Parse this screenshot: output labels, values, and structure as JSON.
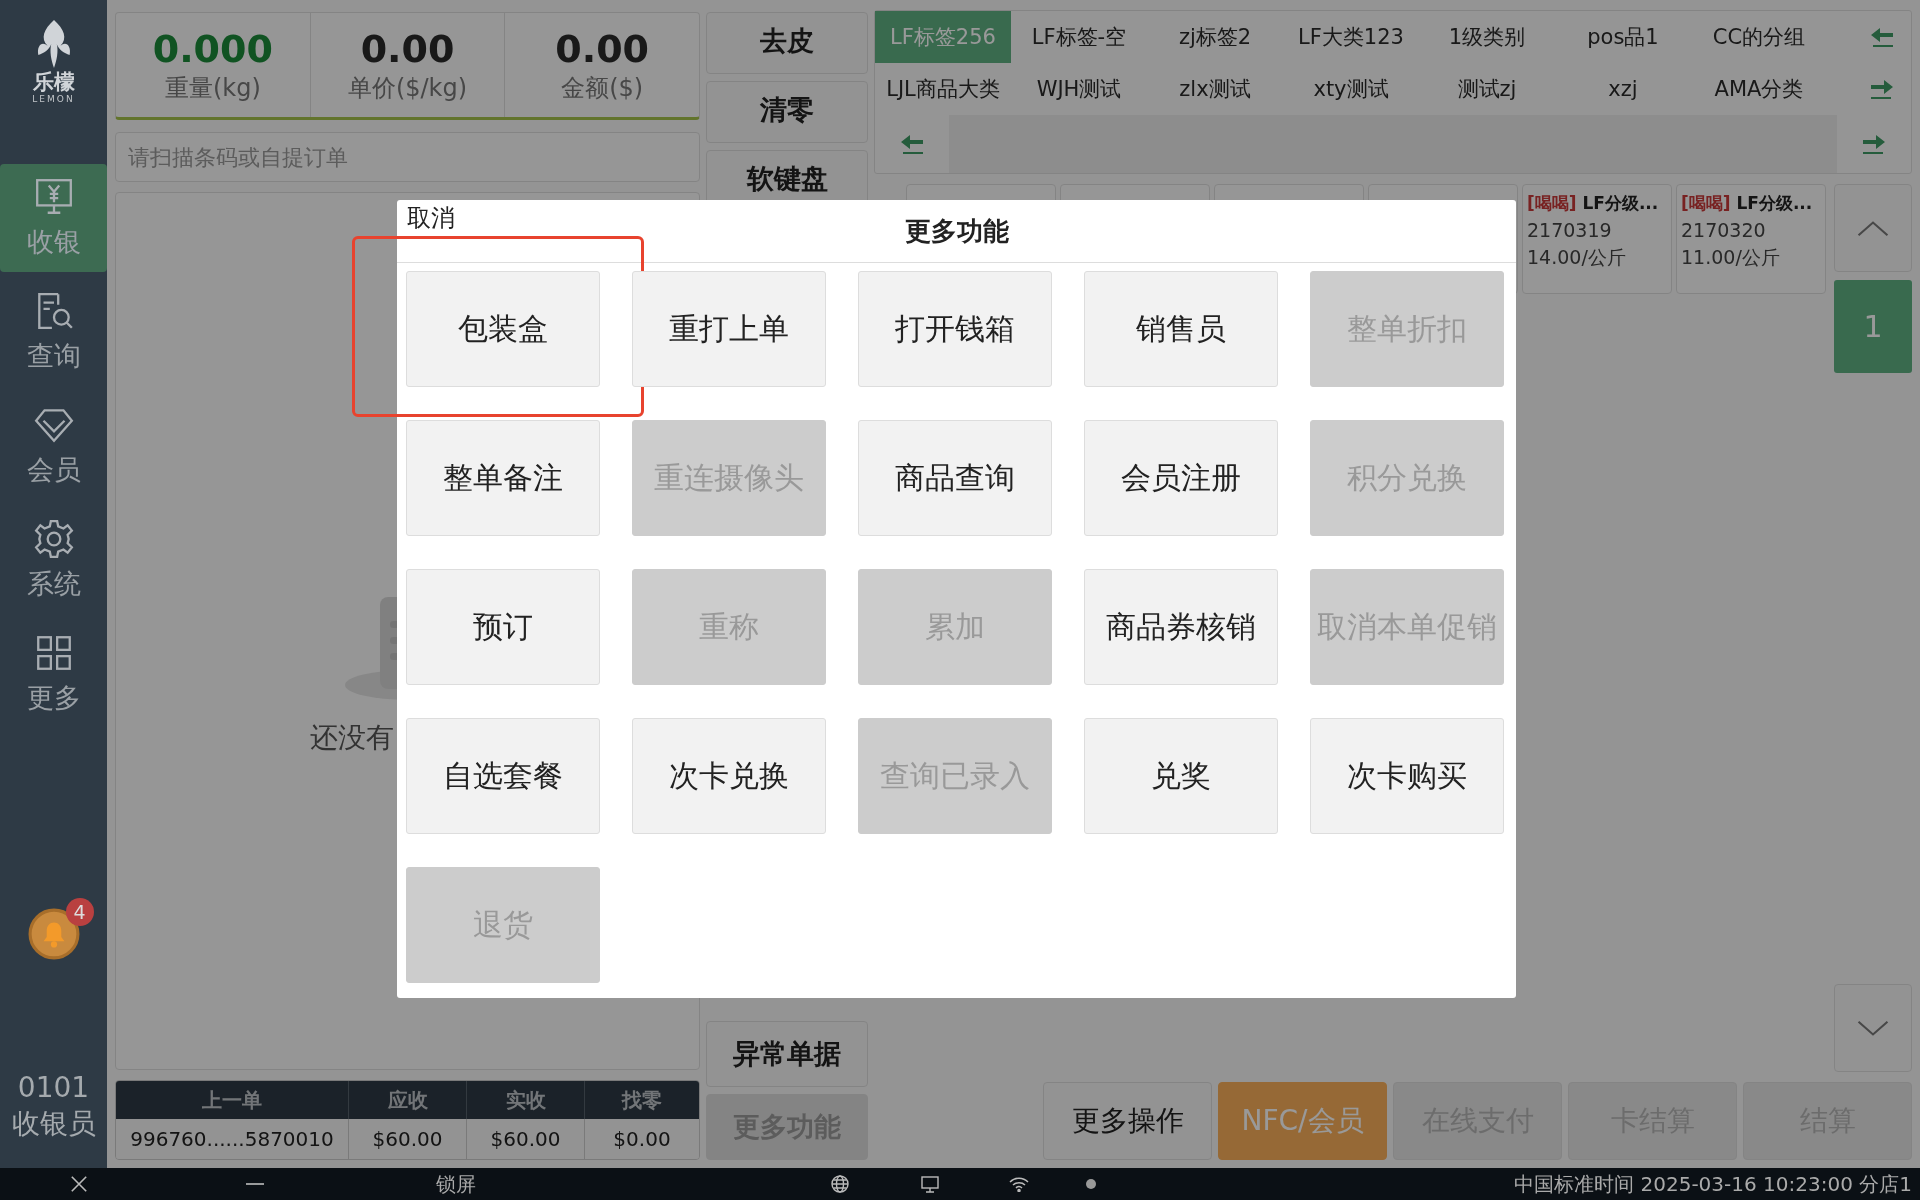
{
  "sidebar": {
    "logo": {
      "name": "乐檬",
      "subtitle": "LEMON"
    },
    "items": [
      {
        "label": "收银",
        "kind": "cashier",
        "selected": true
      },
      {
        "label": "查询",
        "kind": "query",
        "selected": false
      },
      {
        "label": "会员",
        "kind": "member",
        "selected": false
      },
      {
        "label": "系统",
        "kind": "system",
        "selected": false
      },
      {
        "label": "更多",
        "kind": "more",
        "selected": false
      }
    ],
    "notifications": {
      "count": "4"
    },
    "operator": {
      "id": "0101",
      "role": "收银员"
    }
  },
  "scale": {
    "readings": [
      {
        "value": "0.000",
        "label": "重量(kg)",
        "kind": "weight"
      },
      {
        "value": "0.00",
        "label": "单价($/kg)",
        "kind": "price"
      },
      {
        "value": "0.00",
        "label": "金额($)",
        "kind": "amount"
      }
    ]
  },
  "scan_field": {
    "placeholder": "请扫描条码或自提订单"
  },
  "cart": {
    "empty_text": "还没有"
  },
  "last_order": {
    "columns": [
      "上一单",
      "应收",
      "实收",
      "找零"
    ],
    "row": [
      "996760......5870010",
      "$60.00",
      "$60.00",
      "$0.00"
    ]
  },
  "quick_buttons": [
    {
      "label": "去皮",
      "disabled": false
    },
    {
      "label": "清零",
      "disabled": false
    },
    {
      "label": "软键盘",
      "disabled": false
    }
  ],
  "lower_buttons": [
    {
      "label": "异常单据",
      "disabled": false
    },
    {
      "label": "更多功能",
      "disabled": true
    }
  ],
  "categories": {
    "rows": [
      [
        {
          "label": "LF标签256",
          "selected": true
        },
        {
          "label": "LF标签-空",
          "selected": false
        },
        {
          "label": "zj标签2",
          "selected": false
        },
        {
          "label": "LF大类123",
          "selected": false
        },
        {
          "label": "1级类别",
          "selected": false
        },
        {
          "label": "pos品1",
          "selected": false
        },
        {
          "label": "CC的分组",
          "selected": false
        }
      ],
      [
        {
          "label": "LJL商品大类",
          "selected": false
        },
        {
          "label": "WJH测试",
          "selected": false
        },
        {
          "label": "zlx测试",
          "selected": false
        },
        {
          "label": "xty测试",
          "selected": false
        },
        {
          "label": "测试zj",
          "selected": false
        },
        {
          "label": "xzj",
          "selected": false
        },
        {
          "label": "AMA分类",
          "selected": false
        }
      ]
    ]
  },
  "products": [
    {
      "kind": "covered"
    },
    {
      "kind": "covered"
    },
    {
      "kind": "covered"
    },
    {
      "kind": "covered"
    },
    {
      "kind": "item",
      "tag": "[喝喝]",
      "name": "LF分级...",
      "code": "2170319",
      "price": "14.00/公斤"
    },
    {
      "kind": "item",
      "tag": "[喝喝]",
      "name": "LF分级...",
      "code": "2170320",
      "price": "11.00/公斤"
    }
  ],
  "pager": {
    "page": "1"
  },
  "actions": [
    {
      "label": "更多操作",
      "kind": "normal"
    },
    {
      "label": "NFC/会员",
      "kind": "accent"
    },
    {
      "label": "在线支付",
      "kind": "disabled"
    },
    {
      "label": "卡结算",
      "kind": "disabled"
    },
    {
      "label": "结算",
      "kind": "disabled"
    }
  ],
  "taskbar": {
    "lock": "锁屏",
    "status": "中国标准时间 2025-03-16 10:23:00 分店1"
  },
  "modal": {
    "cancel": "取消",
    "title": "更多功能",
    "buttons": [
      {
        "label": "包装盒",
        "disabled": false,
        "highlighted": true
      },
      {
        "label": "重打上单",
        "disabled": false,
        "highlighted": false
      },
      {
        "label": "打开钱箱",
        "disabled": false,
        "highlighted": false
      },
      {
        "label": "销售员",
        "disabled": false,
        "highlighted": false
      },
      {
        "label": "整单折扣",
        "disabled": true,
        "highlighted": false
      },
      {
        "label": "整单备注",
        "disabled": false,
        "highlighted": false
      },
      {
        "label": "重连摄像头",
        "disabled": true,
        "highlighted": false
      },
      {
        "label": "商品查询",
        "disabled": false,
        "highlighted": false
      },
      {
        "label": "会员注册",
        "disabled": false,
        "highlighted": false
      },
      {
        "label": "积分兑换",
        "disabled": true,
        "highlighted": false
      },
      {
        "label": "预订",
        "disabled": false,
        "highlighted": false
      },
      {
        "label": "重称",
        "disabled": true,
        "highlighted": false
      },
      {
        "label": "累加",
        "disabled": true,
        "highlighted": false
      },
      {
        "label": "商品券核销",
        "disabled": false,
        "highlighted": false
      },
      {
        "label": "取消本单促销",
        "disabled": true,
        "highlighted": false
      },
      {
        "label": "自选套餐",
        "disabled": false,
        "highlighted": false
      },
      {
        "label": "次卡兑换",
        "disabled": false,
        "highlighted": false
      },
      {
        "label": "查询已录入",
        "disabled": true,
        "highlighted": false
      },
      {
        "label": "兑奖",
        "disabled": false,
        "highlighted": false
      },
      {
        "label": "次卡购买",
        "disabled": false,
        "highlighted": false
      },
      {
        "label": "退货",
        "disabled": true,
        "highlighted": false
      }
    ]
  }
}
